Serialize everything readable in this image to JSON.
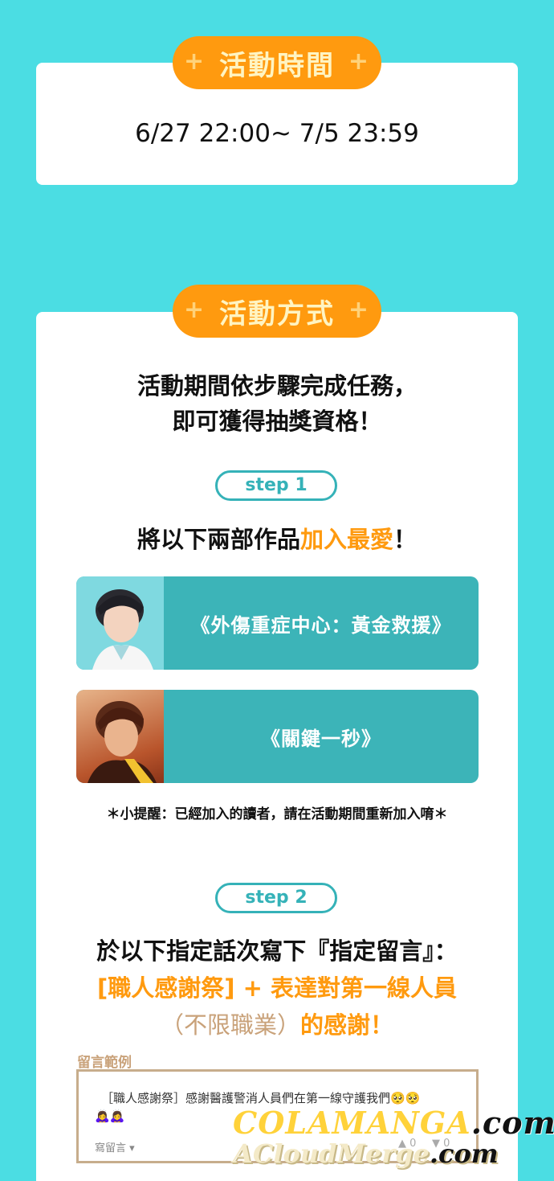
{
  "event_time": {
    "title": "活動時間",
    "value": "6/27 22:00~ 7/5 23:59"
  },
  "event_method": {
    "title": "活動方式",
    "intro_line1": "活動期間依步驟完成任務，",
    "intro_line2": "即可獲得抽獎資格！"
  },
  "pill_plus": "+",
  "step1": {
    "label": "step 1",
    "heading_prefix": "將以下兩部作品",
    "heading_highlight": "加入最愛",
    "heading_suffix": "！",
    "works": [
      {
        "title": "《外傷重症中心：黃金救援》"
      },
      {
        "title": "《關鍵一秒》"
      }
    ],
    "reminder": "＊小提醒：已經加入的讀者，請在活動期間重新加入唷＊"
  },
  "step2": {
    "label": "step 2",
    "line1": "於以下指定話次寫下『指定留言』：",
    "line2": "[職人感謝祭] + 表達對第一線人員",
    "line3_light": "（不限職業）",
    "line3_highlight": "的感謝！",
    "example_label": "留言範例",
    "example_comment": "［職人感謝祭］感謝醫護警消人員們在第一線守護我們🥺🥺",
    "example_emoji": "🙇‍♀️🙇‍♀️",
    "write_comment": "寫留言 ▾",
    "like_count": "0",
    "dislike_count": "0"
  },
  "watermark": {
    "line1_brand": "COLAMANGA",
    "line1_domain": ".com",
    "line2_brand": "ACloudMerge",
    "line2_domain": ".com"
  },
  "colors": {
    "background": "#4bdde3",
    "accent_orange": "#ff9a0f",
    "teal": "#3cb4b8",
    "card": "#ffffff"
  }
}
